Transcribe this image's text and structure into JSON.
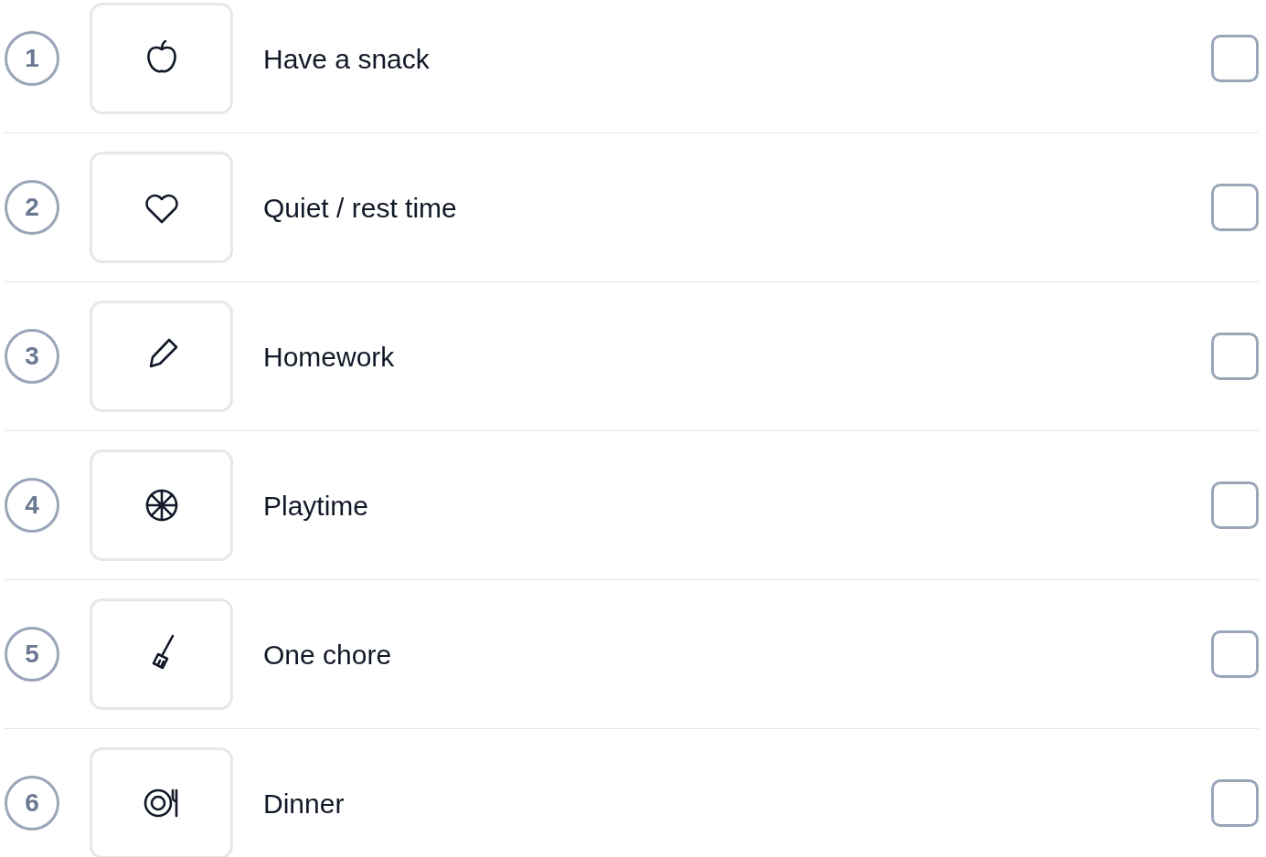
{
  "tasks": [
    {
      "number": "1",
      "label": "Have a snack",
      "checked": false
    },
    {
      "number": "2",
      "label": "Quiet / rest time",
      "checked": false
    },
    {
      "number": "3",
      "label": "Homework",
      "checked": false
    },
    {
      "number": "4",
      "label": "Playtime",
      "checked": false
    },
    {
      "number": "5",
      "label": "One chore",
      "checked": false
    },
    {
      "number": "6",
      "label": "Dinner",
      "checked": false
    }
  ]
}
